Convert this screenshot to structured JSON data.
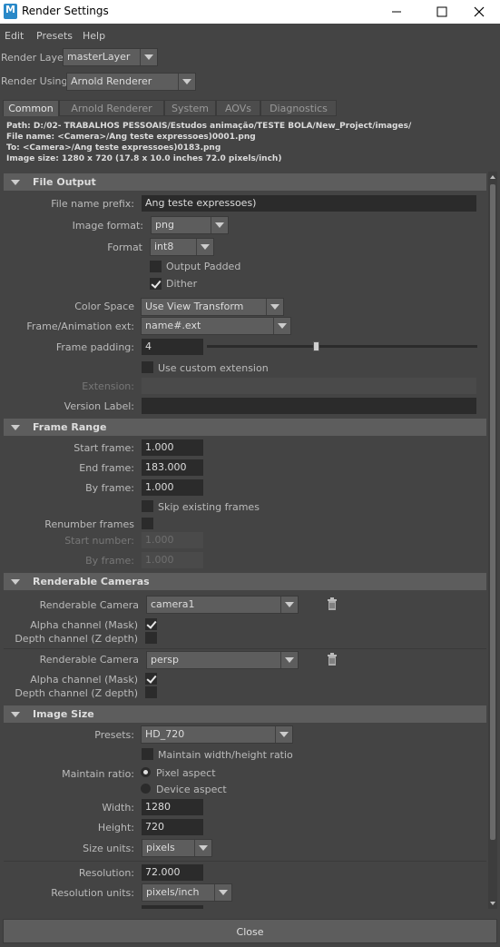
{
  "window": {
    "title": "Render Settings",
    "app_icon_text": "M"
  },
  "menu": [
    "Edit",
    "Presets",
    "Help"
  ],
  "render_layer": {
    "label": "Render Layer",
    "value": "masterLayer"
  },
  "render_using": {
    "label": "Render Using",
    "value": "Arnold Renderer"
  },
  "tabs": [
    "Common",
    "Arnold Renderer",
    "System",
    "AOVs",
    "Diagnostics"
  ],
  "info": {
    "path": "Path: D:/02- TRABALHOS PESSOAIS/Estudos animação/TESTE BOLA/New_Project/images/",
    "file_name": "File name:  <Camera>/Ang teste expressoes)0001.png",
    "to": "To:             <Camera>/Ang teste expressoes)0183.png",
    "image_size": "Image size: 1280 x 720 (17.8 x 10.0 inches 72.0 pixels/inch)"
  },
  "file_output": {
    "header": "File Output",
    "prefix_label": "File name prefix:",
    "prefix_value": "Ang teste expressoes)",
    "image_format_label": "Image format:",
    "image_format_value": "png",
    "format_label": "Format",
    "format_value": "int8",
    "output_padded_label": "Output Padded",
    "dither_label": "Dither",
    "color_space_label": "Color Space",
    "color_space_value": "Use View Transform",
    "frame_ext_label": "Frame/Animation ext:",
    "frame_ext_value": "name#.ext",
    "frame_padding_label": "Frame padding:",
    "frame_padding_value": "4",
    "custom_ext_label": "Use custom extension",
    "extension_label": "Extension:",
    "version_label": "Version Label:"
  },
  "frame_range": {
    "header": "Frame Range",
    "start_label": "Start frame:",
    "start_value": "1.000",
    "end_label": "End frame:",
    "end_value": "183.000",
    "by_label": "By frame:",
    "by_value": "1.000",
    "skip_label": "Skip existing frames",
    "renumber_label": "Renumber frames",
    "start_number_label": "Start number:",
    "start_number_value": "1.000",
    "by_frame2_label": "By frame:",
    "by_frame2_value": "1.000"
  },
  "renderable_cameras": {
    "header": "Renderable Cameras",
    "cameras": [
      {
        "label": "Renderable Camera",
        "value": "camera1",
        "alpha_label": "Alpha channel (Mask)",
        "depth_label": "Depth channel (Z depth)"
      },
      {
        "label": "Renderable Camera",
        "value": "persp",
        "alpha_label": "Alpha channel (Mask)",
        "depth_label": "Depth channel (Z depth)"
      }
    ]
  },
  "image_size": {
    "header": "Image Size",
    "presets_label": "Presets:",
    "presets_value": "HD_720",
    "maintain_wh_label": "Maintain width/height ratio",
    "maintain_ratio_label": "Maintain ratio:",
    "pixel_aspect_label": "Pixel aspect",
    "device_aspect_label": "Device aspect",
    "width_label": "Width:",
    "width_value": "1280",
    "height_label": "Height:",
    "height_value": "720",
    "size_units_label": "Size units:",
    "size_units_value": "pixels",
    "resolution_label": "Resolution:",
    "resolution_value": "72.000",
    "resolution_units_label": "Resolution units:",
    "resolution_units_value": "pixels/inch"
  },
  "close_label": "Close",
  "colors": {
    "background": "#444444",
    "header": "#5d5d5d",
    "field": "#2b2b2b"
  }
}
